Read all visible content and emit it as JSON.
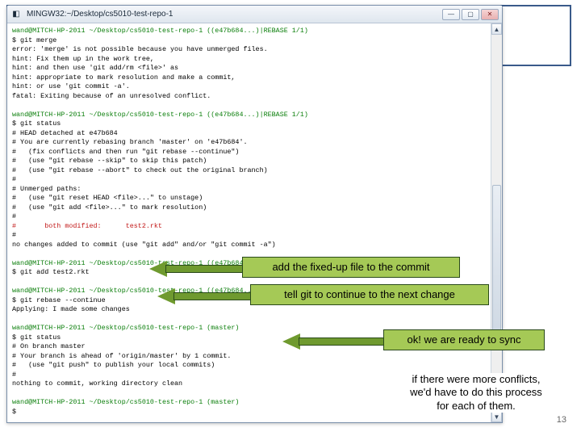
{
  "window": {
    "title": "MINGW32:~/Desktop/cs5010-test-repo-1"
  },
  "term": {
    "l01": "wand@MITCH-HP-2011 ~/Desktop/cs5010-test-repo-1 ((e47b684...)|REBASE 1/1)",
    "l02": "$ git merge",
    "l03": "error: 'merge' is not possible because you have unmerged files.",
    "l04": "hint: Fix them up in the work tree,",
    "l05": "hint: and then use 'git add/rm <file>' as",
    "l06": "hint: appropriate to mark resolution and make a commit,",
    "l07": "hint: or use 'git commit -a'.",
    "l08": "fatal: Exiting because of an unresolved conflict.",
    "l09": "",
    "l10": "wand@MITCH-HP-2011 ~/Desktop/cs5010-test-repo-1 ((e47b684...)|REBASE 1/1)",
    "l11": "$ git status",
    "l12": "# HEAD detached at e47b684",
    "l13": "# You are currently rebasing branch 'master' on 'e47b684'.",
    "l14": "#   (fix conflicts and then run \"git rebase --continue\")",
    "l15": "#   (use \"git rebase --skip\" to skip this patch)",
    "l16": "#   (use \"git rebase --abort\" to check out the original branch)",
    "l17": "#",
    "l18": "# Unmerged paths:",
    "l19": "#   (use \"git reset HEAD <file>...\" to unstage)",
    "l20": "#   (use \"git add <file>...\" to mark resolution)",
    "l21": "#",
    "l22": "#       both modified:      test2.rkt",
    "l23": "#",
    "l24": "no changes added to commit (use \"git add\" and/or \"git commit -a\")",
    "l25": "",
    "l26": "wand@MITCH-HP-2011 ~/Desktop/cs5010-test-repo-1 ((e47b684...)|REBASE 1/1)",
    "l27": "$ git add test2.rkt",
    "l28": "",
    "l29": "wand@MITCH-HP-2011 ~/Desktop/cs5010-test-repo-1 ((e47b684...)|REBASE 1/1)",
    "l30": "$ git rebase --continue",
    "l31": "Applying: I made some changes",
    "l32": "",
    "l33": "wand@MITCH-HP-2011 ~/Desktop/cs5010-test-repo-1 (master)",
    "l34": "$ git status",
    "l35": "# On branch master",
    "l36": "# Your branch is ahead of 'origin/master' by 1 commit.",
    "l37": "#   (use \"git push\" to publish your local commits)",
    "l38": "#",
    "l39": "nothing to commit, working directory clean",
    "l40": "",
    "l41": "wand@MITCH-HP-2011 ~/Desktop/cs5010-test-repo-1 (master)",
    "l42": "$"
  },
  "callouts": {
    "c1": "add the fixed-up file to the commit",
    "c2": "tell git to continue to the next change",
    "c3": "ok! we are ready to sync"
  },
  "note": {
    "l1": "if there were more conflicts,",
    "l2": "we'd have to do this process",
    "l3": "for each of them."
  },
  "page": "13"
}
